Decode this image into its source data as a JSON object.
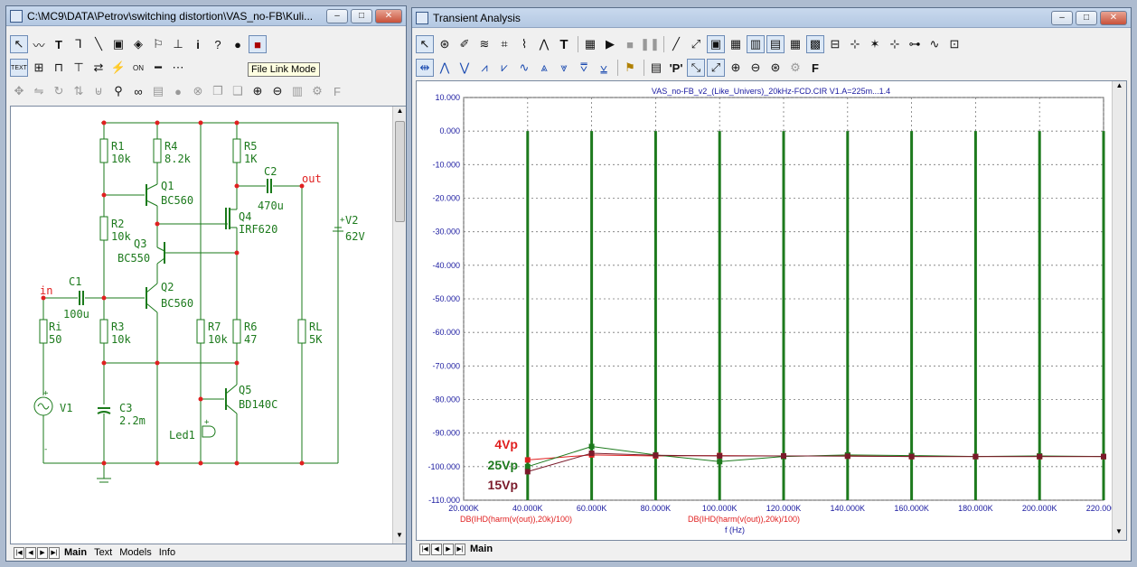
{
  "left_window": {
    "title": "C:\\MC9\\DATA\\Petrov\\switching distortion\\VAS_no-FB\\Kuli...",
    "tooltip": "File Link Mode",
    "tabs": [
      "Main",
      "Text",
      "Models",
      "Info"
    ],
    "active_tab": "Main",
    "schematic": {
      "components": [
        {
          "ref": "R1",
          "value": "10k"
        },
        {
          "ref": "R4",
          "value": "8.2k"
        },
        {
          "ref": "R5",
          "value": "1K"
        },
        {
          "ref": "C2",
          "value": "470u"
        },
        {
          "ref": "Q1",
          "value": "BC560"
        },
        {
          "ref": "Q4",
          "value": "IRF620"
        },
        {
          "ref": "R2",
          "value": "10k"
        },
        {
          "ref": "Q3",
          "value": "BC550"
        },
        {
          "ref": "V2",
          "value": "62V"
        },
        {
          "ref": "C1",
          "value": "100u"
        },
        {
          "ref": "Q2",
          "value": "BC560"
        },
        {
          "ref": "Ri",
          "value": "50"
        },
        {
          "ref": "R3",
          "value": "10k"
        },
        {
          "ref": "R7",
          "value": "10k"
        },
        {
          "ref": "R6",
          "value": "47"
        },
        {
          "ref": "RL",
          "value": "5K"
        },
        {
          "ref": "Q5",
          "value": "BD140C"
        },
        {
          "ref": "V1",
          "value": ""
        },
        {
          "ref": "C3",
          "value": "2.2m"
        },
        {
          "ref": "Led1",
          "value": ""
        }
      ],
      "net_labels": {
        "in": "in",
        "out": "out"
      },
      "plus": "+",
      "minus": "-"
    }
  },
  "right_window": {
    "title": "Transient Analysis",
    "tabs": [
      "Main"
    ],
    "active_tab": "Main",
    "toolbar_text": {
      "text_tool": "T",
      "p_tool": "'P'",
      "f_tool": "F"
    },
    "colors": {
      "green": "#1d7a1d",
      "red": "#e02020",
      "darkred": "#7a1a2a",
      "grid": "#7a7a7a",
      "blue": "#1a1aa0"
    }
  },
  "chart_data": {
    "type": "line",
    "title": "VAS_no-FB_v2_(Like_Univers)_20kHz-FCD.CIR V1.A=225m...1.4",
    "xlabel": "f (Hz)",
    "xlim": [
      20000,
      220000
    ],
    "ylim": [
      -110,
      10
    ],
    "x_ticks": [
      "20.000K",
      "40.000K",
      "60.000K",
      "80.000K",
      "100.000K",
      "120.000K",
      "140.000K",
      "160.000K",
      "180.000K",
      "200.000K",
      "220.000K"
    ],
    "y_ticks": [
      "10.000",
      "0.000",
      "-10.000",
      "-20.000",
      "-30.000",
      "-40.000",
      "-50.000",
      "-60.000",
      "-70.000",
      "-80.000",
      "-90.000",
      "-100.000",
      "-110.000"
    ],
    "expressions": [
      "DB(IHD(harm(v(out)),20k)/100)",
      "DB(IHD(harm(v(out)),20k)/100)"
    ],
    "legend": [
      "4Vp",
      "25Vp",
      "15Vp"
    ],
    "fundamental_spikes_x": [
      40000,
      60000,
      80000,
      100000,
      120000,
      140000,
      160000,
      180000,
      200000,
      220000
    ],
    "spike_top": 0,
    "series": [
      {
        "name": "4Vp",
        "color": "#e02020",
        "x": [
          40000,
          60000,
          80000,
          100000,
          120000,
          140000,
          160000,
          180000,
          200000,
          220000
        ],
        "y": [
          -98,
          -96.5,
          -96.8,
          -96.7,
          -96.8,
          -96.8,
          -97,
          -97,
          -97,
          -97
        ]
      },
      {
        "name": "25Vp",
        "color": "#1d7a1d",
        "x": [
          40000,
          60000,
          80000,
          100000,
          120000,
          140000,
          160000,
          180000,
          200000,
          220000
        ],
        "y": [
          -100,
          -94,
          -96.5,
          -98.5,
          -97,
          -96.5,
          -96.7,
          -97,
          -96.8,
          -97
        ]
      },
      {
        "name": "15Vp",
        "color": "#7a1a2a",
        "x": [
          40000,
          60000,
          80000,
          100000,
          120000,
          140000,
          160000,
          180000,
          200000,
          220000
        ],
        "y": [
          -101.5,
          -96,
          -96.6,
          -96.8,
          -96.8,
          -96.9,
          -97,
          -97,
          -97,
          -97
        ]
      }
    ]
  }
}
